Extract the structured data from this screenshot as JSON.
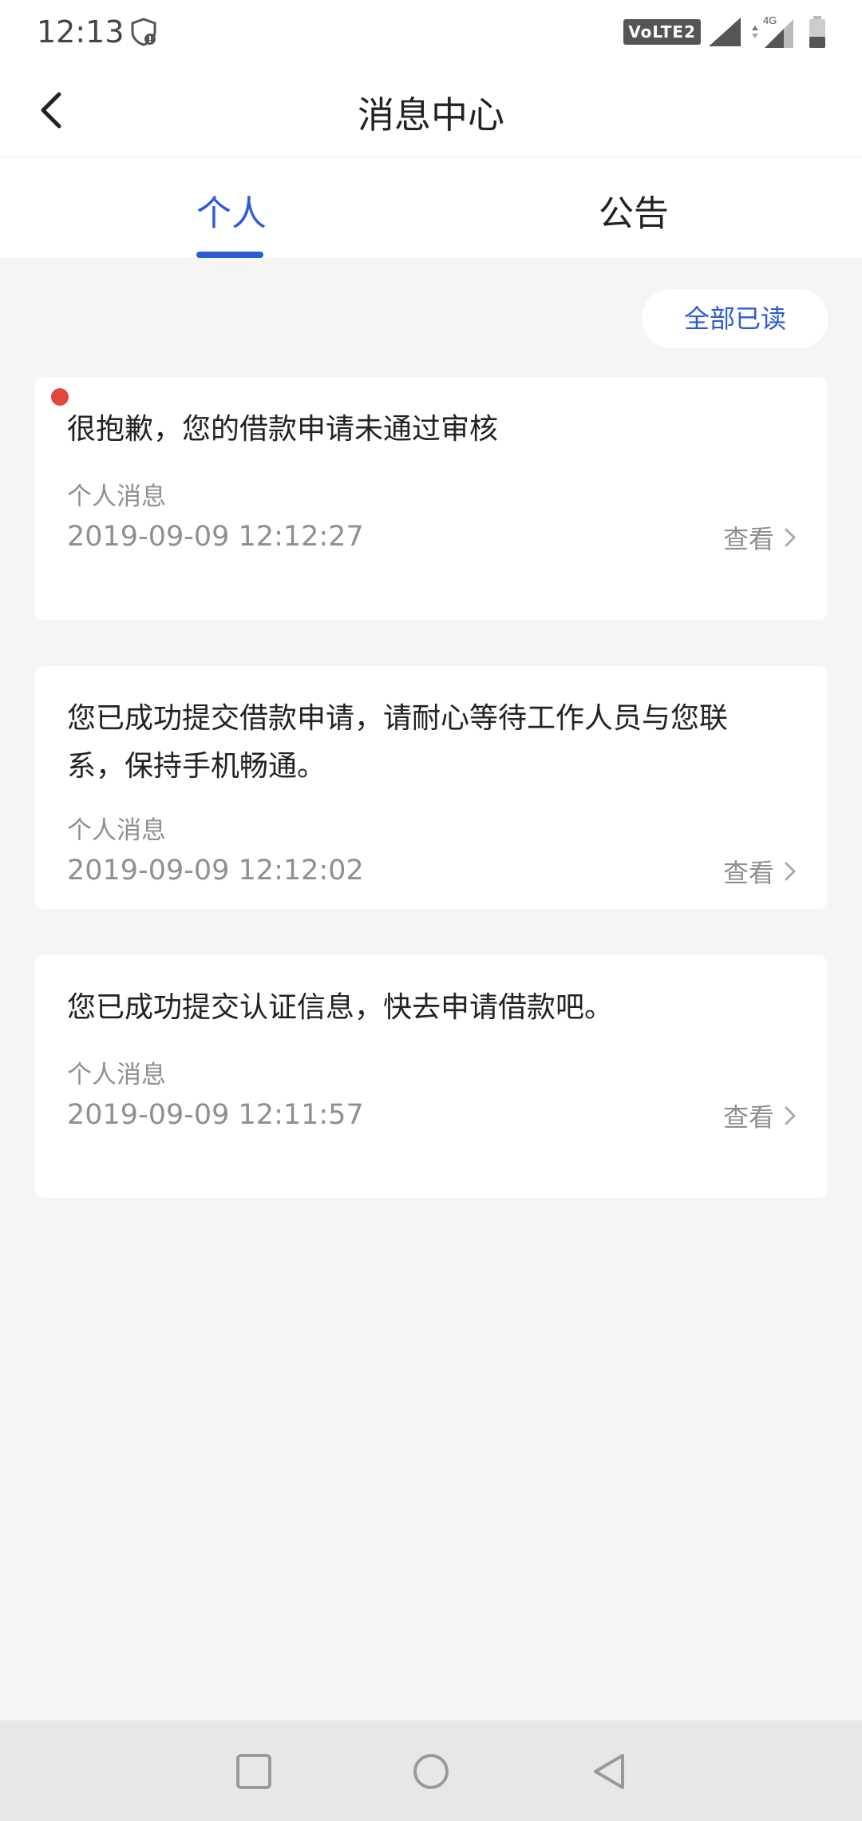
{
  "status_bar": {
    "time": "12:13",
    "volte_label": "VoLTE2",
    "network_label": "4G"
  },
  "header": {
    "title": "消息中心",
    "back_icon": "chevron-left-icon"
  },
  "tabs": [
    {
      "label": "个人",
      "active": true
    },
    {
      "label": "公告",
      "active": false
    }
  ],
  "actions": {
    "mark_all_read": "全部已读"
  },
  "messages": [
    {
      "title": "很抱歉，您的借款申请未通过审核",
      "category": "个人消息",
      "time": "2019-09-09 12:12:27",
      "view_label": "查看",
      "unread": true
    },
    {
      "title": "您已成功提交借款申请，请耐心等待工作人员与您联系，保持手机畅通。",
      "category": "个人消息",
      "time": "2019-09-09 12:12:02",
      "view_label": "查看",
      "unread": false
    },
    {
      "title": "您已成功提交认证信息，快去申请借款吧。",
      "category": "个人消息",
      "time": "2019-09-09 12:11:57",
      "view_label": "查看",
      "unread": false
    }
  ],
  "colors": {
    "accent": "#2d5bd6",
    "unread_dot": "#e0483e",
    "background": "#f5f5f5"
  }
}
